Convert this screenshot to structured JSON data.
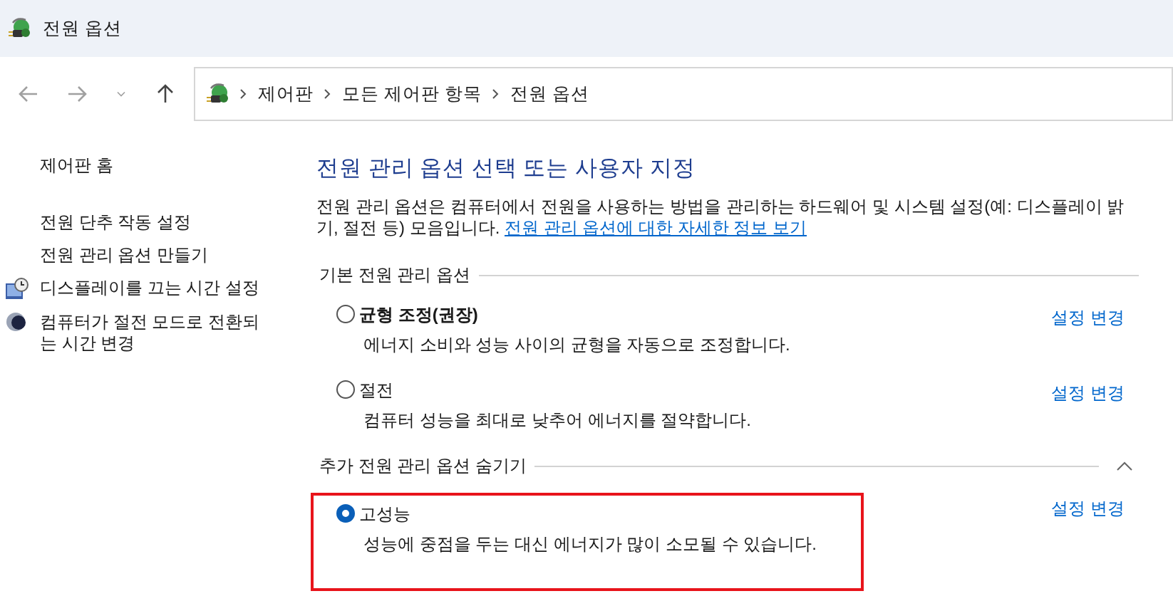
{
  "window": {
    "title": "전원 옵션"
  },
  "nav": [
    {
      "kind": "back",
      "disabled": true
    },
    {
      "kind": "forward",
      "disabled": true
    },
    {
      "kind": "recent",
      "disabled": true
    },
    {
      "kind": "up",
      "disabled": false
    }
  ],
  "breadcrumb": [
    "제어판",
    "모든 제어판 항목",
    "전원 옵션"
  ],
  "sidebar": {
    "home": "제어판 홈",
    "items": [
      {
        "label": "전원 단추 작동 설정",
        "kind": "plain"
      },
      {
        "label": "전원 관리 옵션 만들기",
        "kind": "plain"
      },
      {
        "label": "디스플레이를 끄는 시간 설정",
        "kind": "display"
      },
      {
        "label": "컴퓨터가 절전 모드로 전환되는 시간 변경",
        "kind": "sleep"
      }
    ]
  },
  "main": {
    "heading": "전원 관리 옵션 선택 또는 사용자 지정",
    "intro": "전원 관리 옵션은 컴퓨터에서 전원을 사용하는 방법을 관리하는 하드웨어 및 시스템 설정(예: 디스플레이 밝기, 절전 등) 모음입니다.",
    "intro_link": "전원 관리 옵션에 대한 자세한 정보 보기",
    "sections": [
      {
        "title": "기본 전원 관리 옵션",
        "kind": "plain",
        "plans": [
          {
            "name": "균형 조정(권장)",
            "description": "에너지 소비와 성능 사이의 균형을 자동으로 조정합니다.",
            "link": "설정 변경",
            "selected": false,
            "emphasized": true,
            "highlighted": false
          },
          {
            "name": "절전",
            "description": "컴퓨터 성능을 최대로 낮추어 에너지를 절약합니다.",
            "link": "설정 변경",
            "selected": false,
            "emphasized": false,
            "highlighted": false
          }
        ]
      },
      {
        "title": "추가 전원 관리 옵션 숨기기",
        "kind": "toggle",
        "expanded": true,
        "plans": [
          {
            "name": "고성능",
            "description": "성능에 중점을 두는 대신 에너지가 많이 소모될 수 있습니다.",
            "link": "설정 변경",
            "selected": true,
            "emphasized": false,
            "highlighted": true
          }
        ]
      }
    ]
  }
}
